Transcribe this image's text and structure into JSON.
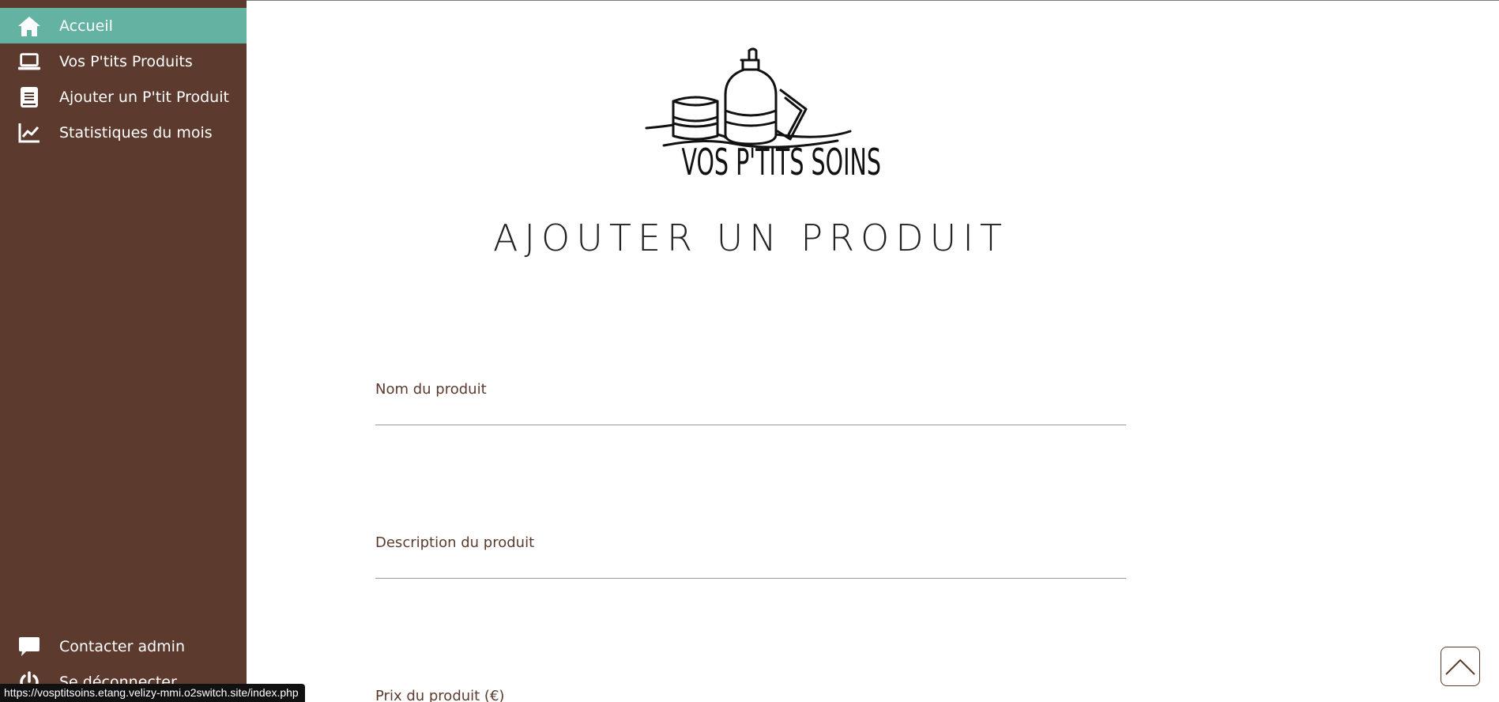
{
  "sidebar": {
    "items": [
      {
        "label": "Accueil",
        "icon": "home-icon"
      },
      {
        "label": "Vos P'tits Produits",
        "icon": "laptop-icon"
      },
      {
        "label": "Ajouter un P'tit Produit",
        "icon": "book-icon"
      },
      {
        "label": "Statistiques du mois",
        "icon": "chart-line-icon"
      }
    ],
    "bottom_items": [
      {
        "label": "Contacter admin",
        "icon": "chat-bubble-icon"
      },
      {
        "label": "Se déconnecter",
        "icon": "power-icon"
      }
    ]
  },
  "logo": {
    "text": "VOS P'TITS SOINS"
  },
  "page": {
    "title": "AJOUTER UN PRODUIT"
  },
  "form": {
    "name_label": "Nom du produit",
    "name_value": "",
    "description_label": "Description du produit",
    "description_value": "",
    "price_label": "Prix du produit (€)"
  },
  "status_bar": {
    "url": "https://vosptitsoins.etang.velizy-mmi.o2switch.site/index.php"
  },
  "colors": {
    "sidebar_bg": "#5c3b2e",
    "active_item_bg": "#64b2a2",
    "label_color": "#5c3b2e"
  }
}
